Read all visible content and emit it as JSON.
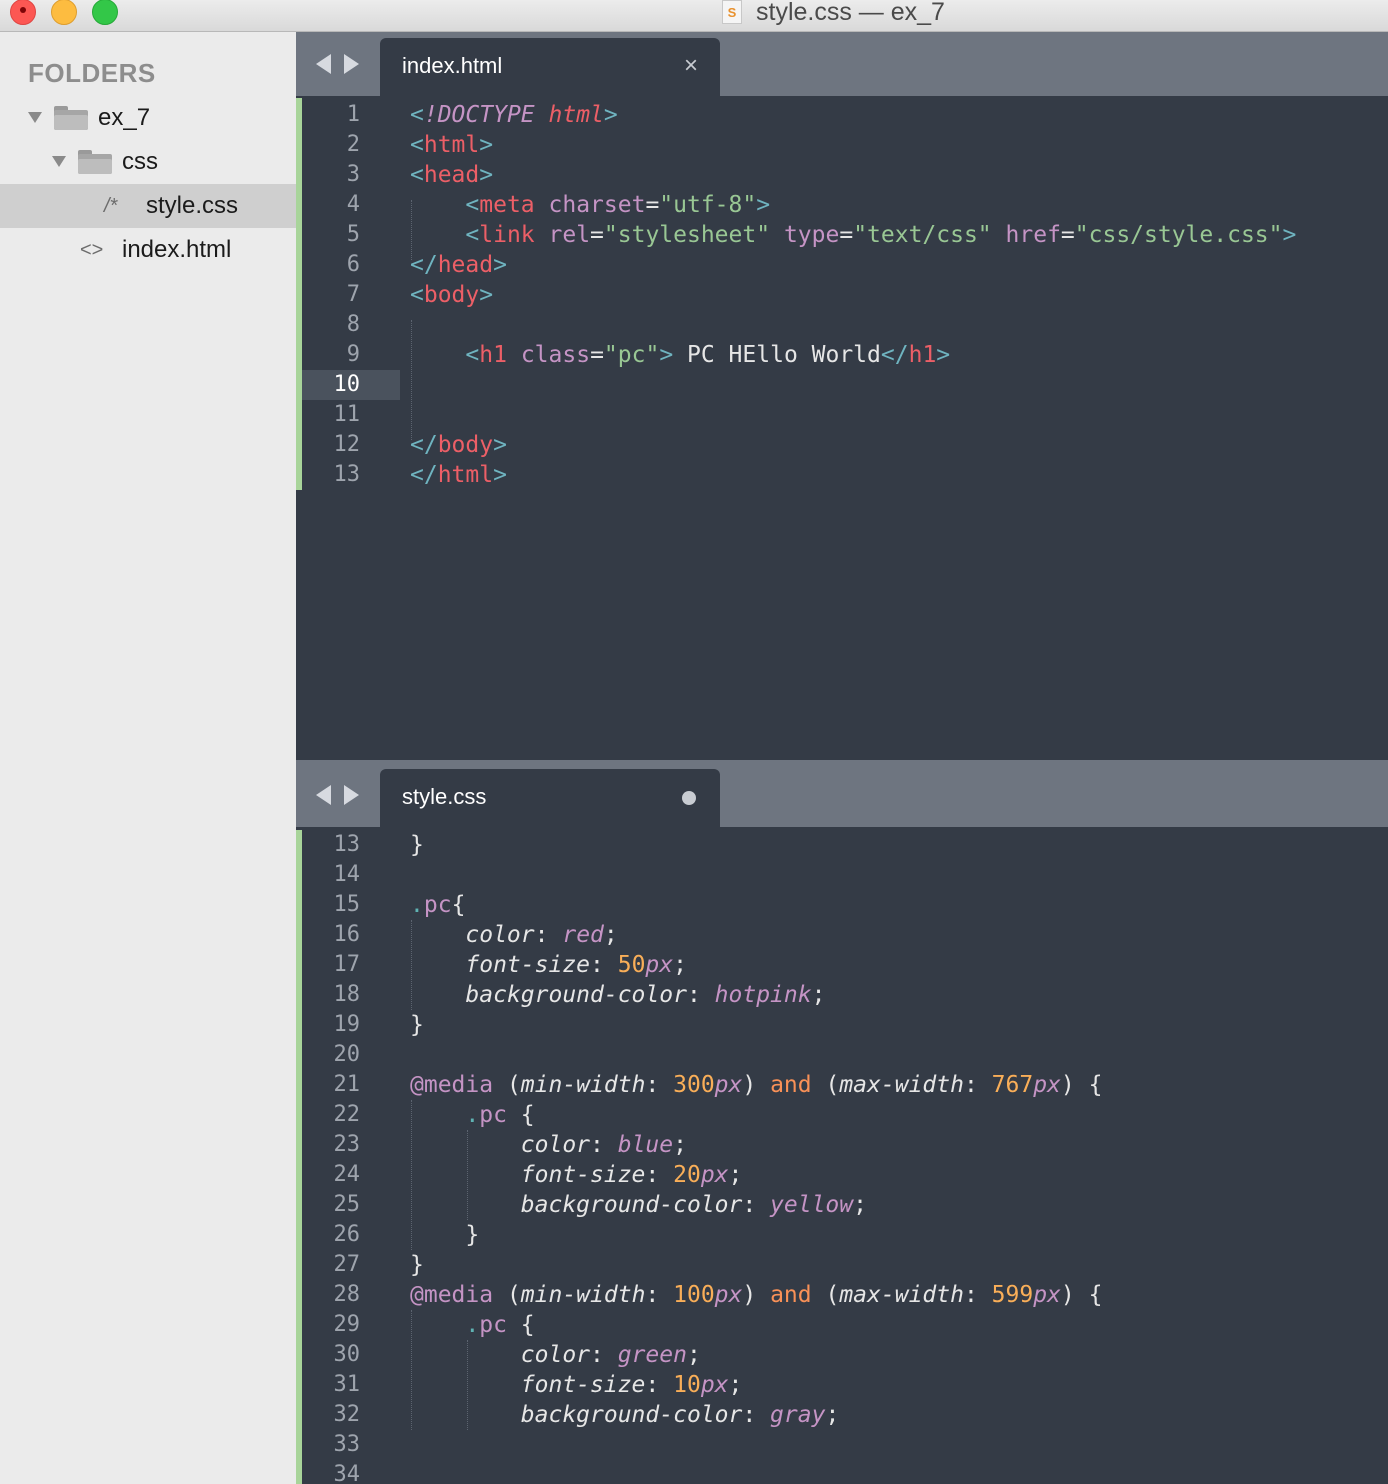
{
  "window": {
    "title": "style.css — ex_7",
    "file_icon_glyph": "S"
  },
  "sidebar": {
    "heading": "FOLDERS",
    "tree": [
      {
        "label": "ex_7",
        "type": "folder",
        "expanded": true
      },
      {
        "label": "css",
        "type": "folder",
        "expanded": true
      },
      {
        "label": "style.css",
        "type": "file",
        "glyph": "/*",
        "selected": true
      },
      {
        "label": "index.html",
        "type": "file",
        "glyph": "<>"
      }
    ]
  },
  "top_pane": {
    "tab_label": "index.html",
    "close_glyph": "×",
    "active_line": 10,
    "lines": [
      {
        "n": "1",
        "tokens": [
          [
            "ang",
            "<"
          ],
          [
            "dt",
            "!DOCTYPE"
          ],
          [
            "p",
            " "
          ],
          [
            "dtn",
            "html"
          ],
          [
            "ang",
            ">"
          ]
        ]
      },
      {
        "n": "2",
        "tokens": [
          [
            "ang",
            "<"
          ],
          [
            "tag",
            "html"
          ],
          [
            "ang",
            ">"
          ]
        ]
      },
      {
        "n": "3",
        "tokens": [
          [
            "ang",
            "<"
          ],
          [
            "tag",
            "head"
          ],
          [
            "ang",
            ">"
          ]
        ]
      },
      {
        "n": "4",
        "tokens": [
          [
            "p",
            "    "
          ],
          [
            "ang",
            "<"
          ],
          [
            "tag",
            "meta"
          ],
          [
            "p",
            " "
          ],
          [
            "attr",
            "charset"
          ],
          [
            "p",
            "="
          ],
          [
            "str",
            "\"utf-8\""
          ],
          [
            "ang",
            ">"
          ]
        ]
      },
      {
        "n": "5",
        "tokens": [
          [
            "p",
            "    "
          ],
          [
            "ang",
            "<"
          ],
          [
            "tag",
            "link"
          ],
          [
            "p",
            " "
          ],
          [
            "attr",
            "rel"
          ],
          [
            "p",
            "="
          ],
          [
            "str",
            "\"stylesheet\""
          ],
          [
            "p",
            " "
          ],
          [
            "attr",
            "type"
          ],
          [
            "p",
            "="
          ],
          [
            "str",
            "\"text/css\""
          ],
          [
            "p",
            " "
          ],
          [
            "attr",
            "href"
          ],
          [
            "p",
            "="
          ],
          [
            "str",
            "\"css/style.css\""
          ],
          [
            "ang",
            ">"
          ]
        ]
      },
      {
        "n": "6",
        "tokens": [
          [
            "ang",
            "</"
          ],
          [
            "tag",
            "head"
          ],
          [
            "ang",
            ">"
          ]
        ]
      },
      {
        "n": "7",
        "tokens": [
          [
            "ang",
            "<"
          ],
          [
            "tag",
            "body"
          ],
          [
            "ang",
            ">"
          ]
        ]
      },
      {
        "n": "8",
        "tokens": []
      },
      {
        "n": "9",
        "tokens": [
          [
            "p",
            "    "
          ],
          [
            "ang",
            "<"
          ],
          [
            "tag",
            "h1"
          ],
          [
            "p",
            " "
          ],
          [
            "attr",
            "class"
          ],
          [
            "p",
            "="
          ],
          [
            "str",
            "\"pc\""
          ],
          [
            "ang",
            ">"
          ],
          [
            "p",
            " PC HEllo World"
          ],
          [
            "ang",
            "</"
          ],
          [
            "tag",
            "h1"
          ],
          [
            "ang",
            ">"
          ]
        ]
      },
      {
        "n": "10",
        "tokens": []
      },
      {
        "n": "11",
        "tokens": []
      },
      {
        "n": "12",
        "tokens": [
          [
            "ang",
            "</"
          ],
          [
            "tag",
            "body"
          ],
          [
            "ang",
            ">"
          ]
        ]
      },
      {
        "n": "13",
        "tokens": [
          [
            "ang",
            "</"
          ],
          [
            "tag",
            "html"
          ],
          [
            "ang",
            ">"
          ]
        ]
      }
    ]
  },
  "bottom_pane": {
    "tab_label": "style.css",
    "lines": [
      {
        "n": "13",
        "tokens": [
          [
            "p",
            "}"
          ]
        ]
      },
      {
        "n": "14",
        "tokens": []
      },
      {
        "n": "15",
        "tokens": [
          [
            "sel-dot",
            "."
          ],
          [
            "sel",
            "pc"
          ],
          [
            "p",
            "{"
          ]
        ]
      },
      {
        "n": "16",
        "tokens": [
          [
            "p",
            "    "
          ],
          [
            "prop",
            "color"
          ],
          [
            "p",
            ": "
          ],
          [
            "val",
            "red"
          ],
          [
            "p",
            ";"
          ]
        ]
      },
      {
        "n": "17",
        "tokens": [
          [
            "p",
            "    "
          ],
          [
            "prop",
            "font-size"
          ],
          [
            "p",
            ": "
          ],
          [
            "num",
            "50"
          ],
          [
            "unit",
            "px"
          ],
          [
            "p",
            ";"
          ]
        ]
      },
      {
        "n": "18",
        "tokens": [
          [
            "p",
            "    "
          ],
          [
            "prop",
            "background-color"
          ],
          [
            "p",
            ": "
          ],
          [
            "val",
            "hotpink"
          ],
          [
            "p",
            ";"
          ]
        ]
      },
      {
        "n": "19",
        "tokens": [
          [
            "p",
            "}"
          ]
        ]
      },
      {
        "n": "20",
        "tokens": []
      },
      {
        "n": "21",
        "tokens": [
          [
            "at",
            "@media"
          ],
          [
            "p",
            " ("
          ],
          [
            "mf",
            "min-width"
          ],
          [
            "p",
            ": "
          ],
          [
            "num",
            "300"
          ],
          [
            "unit",
            "px"
          ],
          [
            "p",
            ") "
          ],
          [
            "kw",
            "and"
          ],
          [
            "p",
            " ("
          ],
          [
            "mf",
            "max-width"
          ],
          [
            "p",
            ": "
          ],
          [
            "num",
            "767"
          ],
          [
            "unit",
            "px"
          ],
          [
            "p",
            ") {"
          ]
        ]
      },
      {
        "n": "22",
        "tokens": [
          [
            "p",
            "    "
          ],
          [
            "sel-dot",
            "."
          ],
          [
            "sel",
            "pc"
          ],
          [
            "p",
            " {"
          ]
        ]
      },
      {
        "n": "23",
        "tokens": [
          [
            "p",
            "        "
          ],
          [
            "prop",
            "color"
          ],
          [
            "p",
            ": "
          ],
          [
            "val",
            "blue"
          ],
          [
            "p",
            ";"
          ]
        ]
      },
      {
        "n": "24",
        "tokens": [
          [
            "p",
            "        "
          ],
          [
            "prop",
            "font-size"
          ],
          [
            "p",
            ": "
          ],
          [
            "num",
            "20"
          ],
          [
            "unit",
            "px"
          ],
          [
            "p",
            ";"
          ]
        ]
      },
      {
        "n": "25",
        "tokens": [
          [
            "p",
            "        "
          ],
          [
            "prop",
            "background-color"
          ],
          [
            "p",
            ": "
          ],
          [
            "val",
            "yellow"
          ],
          [
            "p",
            ";"
          ]
        ]
      },
      {
        "n": "26",
        "tokens": [
          [
            "p",
            "    }"
          ]
        ]
      },
      {
        "n": "27",
        "tokens": [
          [
            "p",
            "}"
          ]
        ]
      },
      {
        "n": "28",
        "tokens": [
          [
            "at",
            "@media"
          ],
          [
            "p",
            " ("
          ],
          [
            "mf",
            "min-width"
          ],
          [
            "p",
            ": "
          ],
          [
            "num",
            "100"
          ],
          [
            "unit",
            "px"
          ],
          [
            "p",
            ") "
          ],
          [
            "kw",
            "and"
          ],
          [
            "p",
            " ("
          ],
          [
            "mf",
            "max-width"
          ],
          [
            "p",
            ": "
          ],
          [
            "num",
            "599"
          ],
          [
            "unit",
            "px"
          ],
          [
            "p",
            ") {"
          ]
        ]
      },
      {
        "n": "29",
        "tokens": [
          [
            "p",
            "    "
          ],
          [
            "sel-dot",
            "."
          ],
          [
            "sel",
            "pc"
          ],
          [
            "p",
            " {"
          ]
        ]
      },
      {
        "n": "30",
        "tokens": [
          [
            "p",
            "        "
          ],
          [
            "prop",
            "color"
          ],
          [
            "p",
            ": "
          ],
          [
            "val",
            "green"
          ],
          [
            "p",
            ";"
          ]
        ]
      },
      {
        "n": "31",
        "tokens": [
          [
            "p",
            "        "
          ],
          [
            "prop",
            "font-size"
          ],
          [
            "p",
            ": "
          ],
          [
            "num",
            "10"
          ],
          [
            "unit",
            "px"
          ],
          [
            "p",
            ";"
          ]
        ]
      },
      {
        "n": "32",
        "tokens": [
          [
            "p",
            "        "
          ],
          [
            "prop",
            "background-color"
          ],
          [
            "p",
            ": "
          ],
          [
            "val",
            "gray"
          ],
          [
            "p",
            ";"
          ]
        ]
      },
      {
        "n": "33",
        "tokens": []
      },
      {
        "n": "34",
        "tokens": []
      }
    ]
  },
  "colors": {
    "editor_bg": "#343b46",
    "tabbar_bg": "#6e7580",
    "sidebar_bg": "#ebebeb",
    "modified_marker": "#a8d49a",
    "tag": "#ec5f67",
    "attribute": "#c594c5",
    "string": "#99c794",
    "number": "#f9ae58",
    "keyword": "#f99157"
  }
}
